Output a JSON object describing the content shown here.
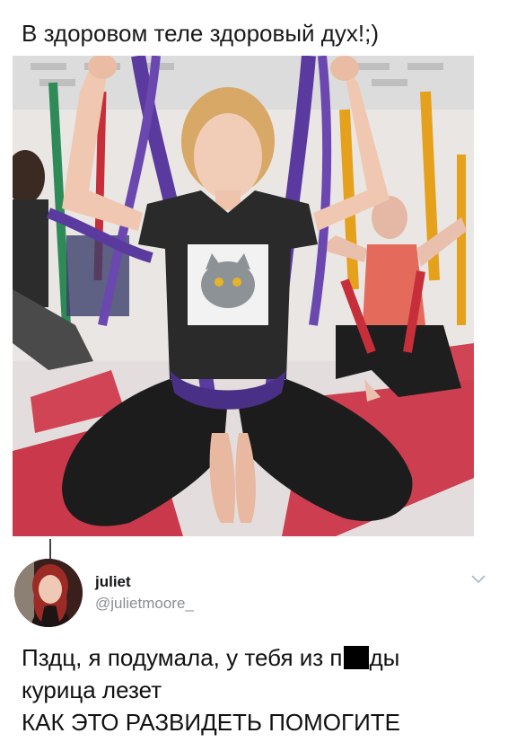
{
  "header_caption": "В здоровом теле здоровый дух!;)",
  "tweet": {
    "display_name": "juliet",
    "handle": "@julietmoore_",
    "line1_before_censor": "Пздц, я подумала, у тебя из п",
    "line1_after_censor": "ды",
    "line2": "курица лезет",
    "line3": "КАК ЭТО РАЗВИДЕТЬ ПОМОГИТЕ"
  },
  "icons": {
    "more": "chevron-down-icon",
    "censor": "redaction-bar"
  },
  "colors": {
    "hammock_purple": "#5a3a9e",
    "hammock_red": "#c62f3a",
    "hammock_yellow": "#e5a11c",
    "mat_red": "#c8384a",
    "handle_gray": "#8a8f94"
  }
}
